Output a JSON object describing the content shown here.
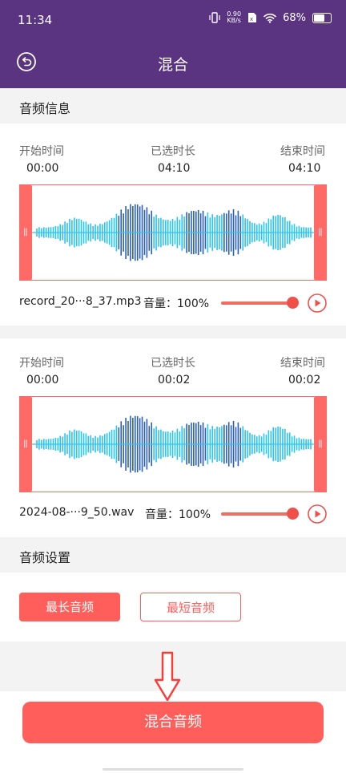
{
  "status_bar": {
    "time": "11:34",
    "speed_value": "0.90",
    "speed_unit": "KB/s",
    "battery": "68%"
  },
  "header": {
    "title": "混合",
    "back_icon": "back-circle-icon"
  },
  "sections": {
    "audio_info": "音频信息",
    "audio_settings": "音频设置"
  },
  "labels": {
    "start_time": "开始时间",
    "selected_duration": "已选时长",
    "end_time": "结束时间",
    "volume": "音量："
  },
  "tracks": [
    {
      "start": "00:00",
      "duration": "04:10",
      "end": "04:10",
      "file": "record_20···8_37.mp3",
      "volume": "100%",
      "volume_level": 1.0
    },
    {
      "start": "00:00",
      "duration": "00:02",
      "end": "00:02",
      "file": "2024-08-···9_50.wav",
      "volume": "100%",
      "volume_level": 1.0
    }
  ],
  "settings": {
    "longest": "最长音频",
    "shortest": "最短音频",
    "selected": "longest"
  },
  "actions": {
    "mix": "混合音频"
  },
  "colors": {
    "header_bg": "#5a3480",
    "accent": "#ff5e5a",
    "wave_light": "#29c5f6",
    "wave_dark": "#2b5fb4"
  }
}
